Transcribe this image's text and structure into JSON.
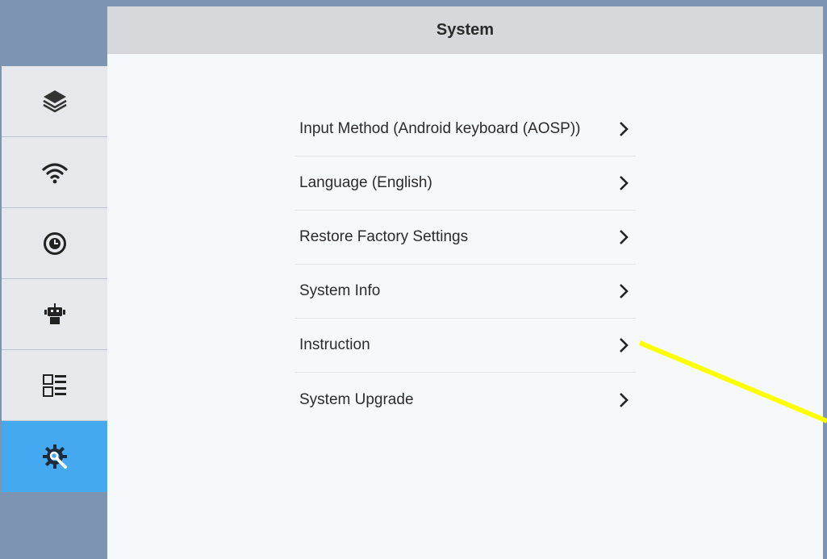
{
  "header": {
    "title": "System"
  },
  "sidebar": {
    "items": [
      {
        "icon": "layers-icon",
        "active": false
      },
      {
        "icon": "wifi-icon",
        "active": false
      },
      {
        "icon": "clock-icon",
        "active": false
      },
      {
        "icon": "robot-icon",
        "active": false
      },
      {
        "icon": "list-icon",
        "active": false
      },
      {
        "icon": "gear-wrench-icon",
        "active": true
      }
    ],
    "active_color": "#45a9ef"
  },
  "menu": {
    "items": [
      {
        "label": "Input Method (Android keyboard (AOSP))"
      },
      {
        "label": "Language (English)"
      },
      {
        "label": "Restore Factory Settings"
      },
      {
        "label": "System Info"
      },
      {
        "label": "Instruction"
      },
      {
        "label": "System Upgrade"
      }
    ]
  },
  "annotation": {
    "color": "#ffff00"
  }
}
